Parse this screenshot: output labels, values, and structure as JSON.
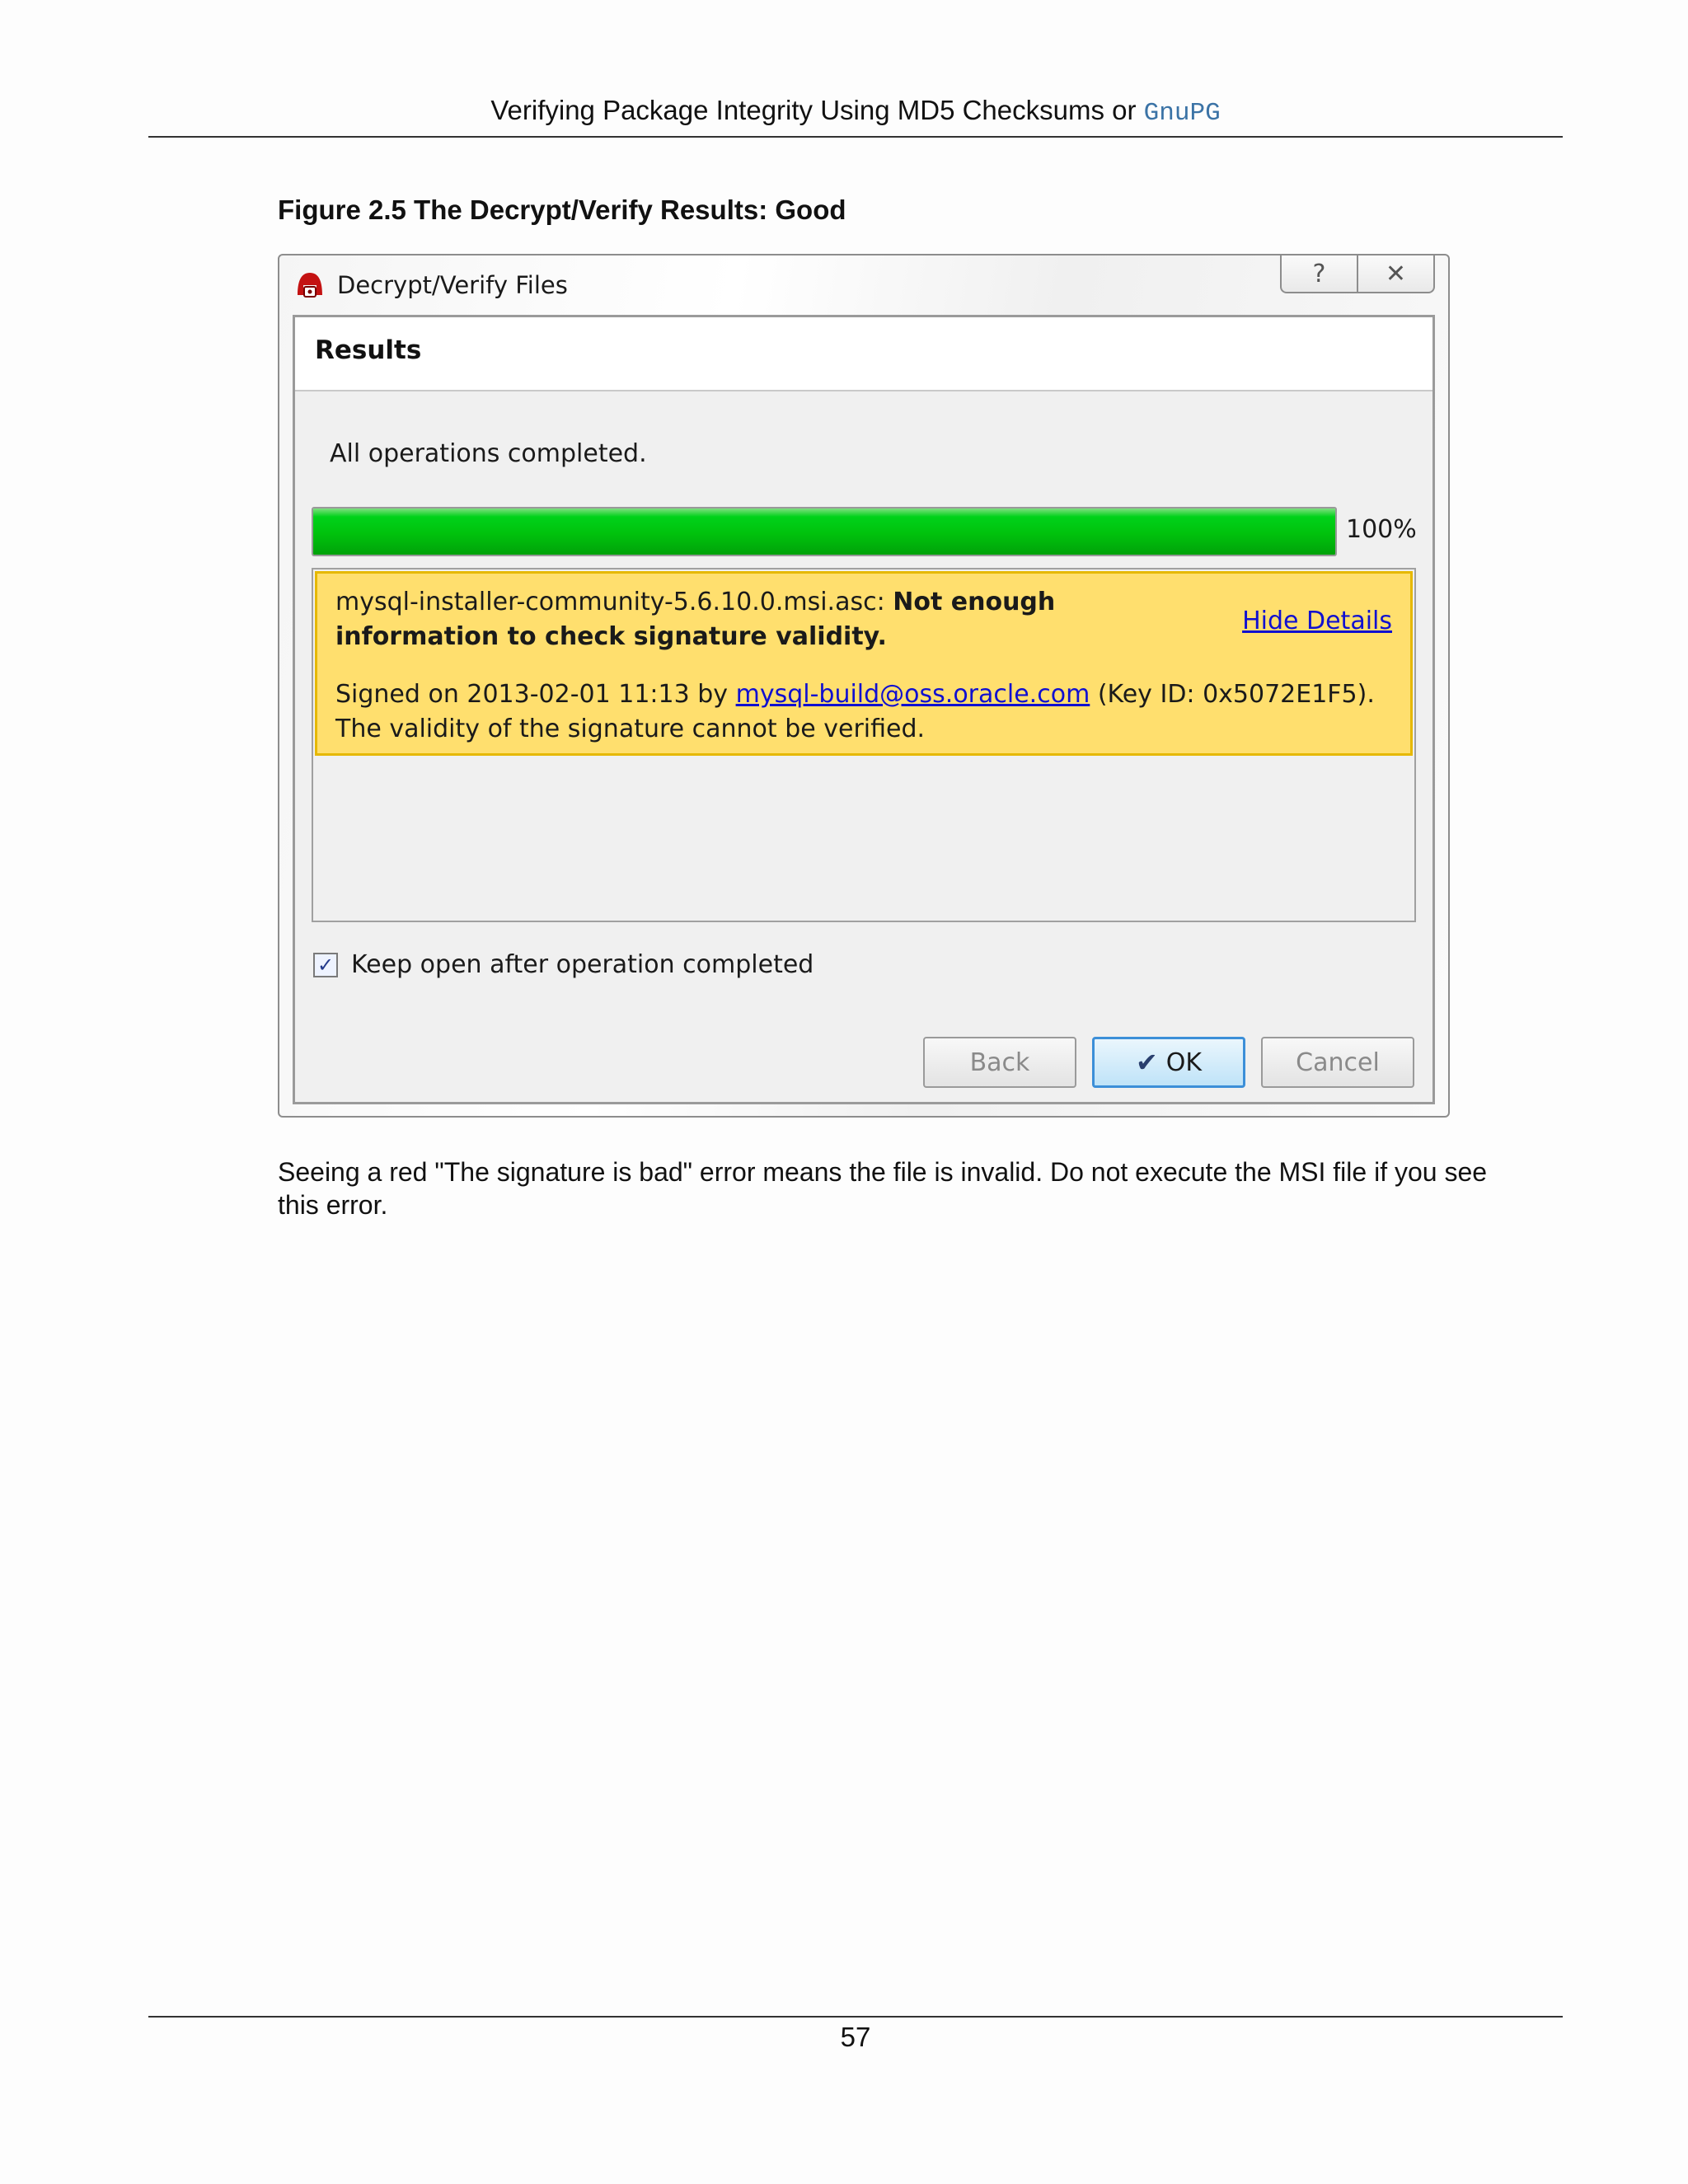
{
  "header": {
    "title": "Verifying Package Integrity Using MD5 Checksums or",
    "title_code": "GnuPG"
  },
  "figure": {
    "caption": "Figure 2.5 The Decrypt/Verify Results: Good"
  },
  "dialog": {
    "window_title": "Decrypt/Verify Files",
    "help_glyph": "?",
    "close_glyph": "✕",
    "section_title": "Results",
    "status": "All operations completed.",
    "progress": {
      "value": 1.0,
      "label": "100%"
    },
    "result": {
      "filename": "mysql-installer-community-5.6.10.0.msi.asc:",
      "message": "Not enough information to check signature validity.",
      "hide_details": "Hide Details",
      "signed_prefix": "Signed on 2013-02-01 11:13 by",
      "signer_email": "mysql-build@oss.oracle.com",
      "key_id": "(Key ID: 0x5072E1F5).",
      "validity": "The validity of the signature cannot be verified."
    },
    "keep_open": {
      "label": "Keep open after operation completed",
      "checked": true
    },
    "buttons": {
      "back": "Back",
      "ok": "OK",
      "cancel": "Cancel"
    }
  },
  "body_text": "Seeing a red \"The signature is bad\" error means the file is invalid. Do not execute the MSI file if you see this error.",
  "footer": {
    "page_number": "57"
  },
  "colors": {
    "progress": "#00c20c",
    "warning_bg": "#ffdf6e",
    "warning_border": "#e6b800",
    "link": "#1010d0",
    "ok_border": "#3c8fd8"
  },
  "icons": {
    "app": "gpg4win-app-icon",
    "help": "help-icon",
    "close": "close-icon",
    "checkmark": "checkmark-icon"
  }
}
